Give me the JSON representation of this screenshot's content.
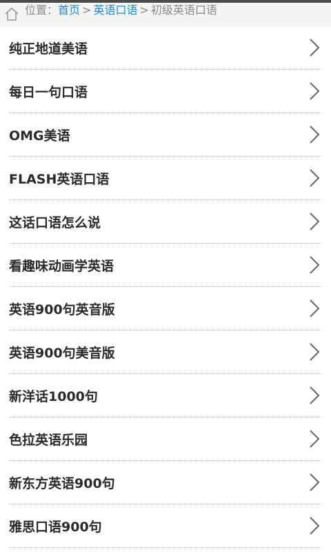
{
  "breadcrumb": {
    "prefix": "位置：",
    "home": "首页",
    "separator": ">",
    "category": "英语口语",
    "current": "初级英语口语"
  },
  "colors": {
    "link": "#1a8ad6",
    "muted": "#888888",
    "text": "#2a2a2a"
  },
  "icons": {
    "home": "home-icon",
    "item_arrow": "chevron-right-icon"
  },
  "items": [
    {
      "label": "纯正地道美语"
    },
    {
      "label": "每日一句口语"
    },
    {
      "label": "OMG美语"
    },
    {
      "label": "FLASH英语口语"
    },
    {
      "label": "这话口语怎么说"
    },
    {
      "label": "看趣味动画学英语"
    },
    {
      "label": "英语900句英音版"
    },
    {
      "label": "英语900句美音版"
    },
    {
      "label": "新洋话1000句"
    },
    {
      "label": "色拉英语乐园"
    },
    {
      "label": "新东方英语900句"
    },
    {
      "label": "雅思口语900句"
    }
  ]
}
